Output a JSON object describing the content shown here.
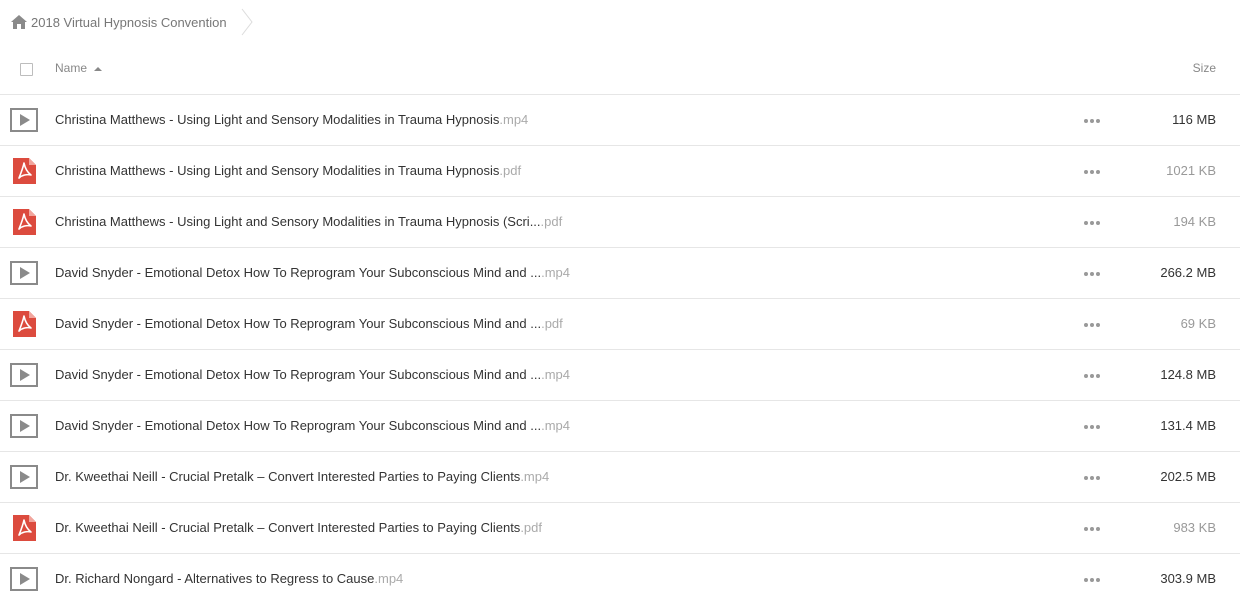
{
  "breadcrumb": {
    "label": "2018 Virtual Hypnosis Convention",
    "icon": "home-icon"
  },
  "table": {
    "name_header": "Name",
    "size_header": "Size",
    "sort": "ascending"
  },
  "colors": {
    "pdf": "#dc4b3e",
    "video_border": "#8a8a8a",
    "text": "#333333",
    "muted": "#aaaaaa"
  },
  "files": [
    {
      "name": "Christina Matthews - Using Light and Sensory Modalities in Trauma Hypnosis",
      "ext": ".mp4",
      "size": "116 MB",
      "type": "video"
    },
    {
      "name": "Christina Matthews - Using Light and Sensory Modalities in Trauma Hypnosis",
      "ext": ".pdf",
      "size": "1021 KB",
      "type": "pdf"
    },
    {
      "name": "Christina Matthews - Using Light and Sensory Modalities in Trauma Hypnosis (Scri...",
      "ext": ".pdf",
      "size": "194 KB",
      "type": "pdf"
    },
    {
      "name": "David Snyder - Emotional Detox How To Reprogram Your Subconscious Mind and ...",
      "ext": ".mp4",
      "size": "266.2 MB",
      "type": "video"
    },
    {
      "name": "David Snyder - Emotional Detox How To Reprogram Your Subconscious Mind and ...",
      "ext": ".pdf",
      "size": "69 KB",
      "type": "pdf"
    },
    {
      "name": "David Snyder - Emotional Detox How To Reprogram Your Subconscious Mind and ...",
      "ext": ".mp4",
      "size": "124.8 MB",
      "type": "video"
    },
    {
      "name": "David Snyder - Emotional Detox How To Reprogram Your Subconscious Mind and ...",
      "ext": ".mp4",
      "size": "131.4 MB",
      "type": "video"
    },
    {
      "name": "Dr. Kweethai Neill - Crucial Pretalk – Convert Interested Parties to Paying Clients",
      "ext": ".mp4",
      "size": "202.5 MB",
      "type": "video"
    },
    {
      "name": "Dr. Kweethai Neill - Crucial Pretalk – Convert Interested Parties to Paying Clients",
      "ext": ".pdf",
      "size": "983 KB",
      "type": "pdf"
    },
    {
      "name": "Dr. Richard Nongard - Alternatives to Regress to Cause",
      "ext": ".mp4",
      "size": "303.9 MB",
      "type": "video"
    }
  ]
}
